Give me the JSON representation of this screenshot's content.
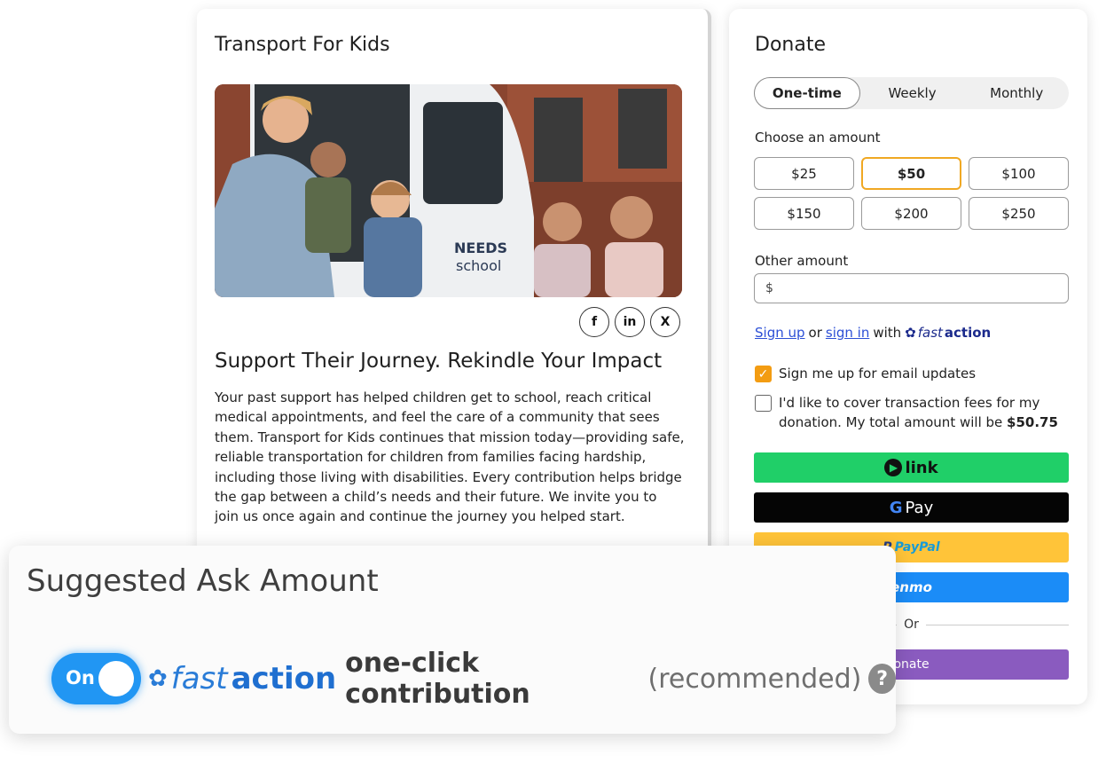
{
  "campaign": {
    "title": "Transport For Kids",
    "van_text_1": "NEEDS",
    "van_text_2": "school",
    "heading": "Support Their Journey. Rekindle Your Impact",
    "body": "Your past support has helped children get to school, reach critical medical appointments, and feel the care of a community that sees them. Transport for Kids continues that mission today—providing safe, reliable transportation for children from families facing hardship, including those living with disabilities. Every contribution helps bridge the gap between a child’s needs and their future. We invite you to join us once again and continue the journey you helped start.",
    "share": [
      "facebook-icon",
      "linkedin-icon",
      "x-icon"
    ],
    "share_glyphs": {
      "facebook": "f",
      "linkedin": "in",
      "x": "X"
    }
  },
  "donate": {
    "title": "Donate",
    "frequency": [
      "One-time",
      "Weekly",
      "Monthly"
    ],
    "frequency_selected": "One-time",
    "choose_label": "Choose an amount",
    "amounts": [
      "$25",
      "$50",
      "$100",
      "$150",
      "$200",
      "$250"
    ],
    "amount_selected": "$50",
    "other_label": "Other amount",
    "other_placeholder": "$",
    "signup_link": "Sign up",
    "or_text": "or",
    "signin_link": "sign in",
    "with_text": "with",
    "fastaction_fast": "fast",
    "fastaction_action": "action",
    "email_updates": "Sign me up for email updates",
    "email_checked": true,
    "cover_fees_line1": "I'd like to cover transaction fees for my",
    "cover_fees_line2": "donation. My total amount will be",
    "cover_fees_total": "$50.75",
    "cover_checked": false,
    "pay_link": "link",
    "pay_gpay": "Pay",
    "pay_paypal": "PayPal",
    "pay_venmo": "enmo",
    "divider_or": "Or",
    "submit": "onate",
    "accent_color": "#f0a823"
  },
  "overlay": {
    "title": "Suggested Ask Amount",
    "toggle_label": "On",
    "toggle_on": true,
    "fast": "fast",
    "action": "action",
    "contribution": "one-click contribution",
    "recommended": "(recommended)",
    "help": "?"
  }
}
